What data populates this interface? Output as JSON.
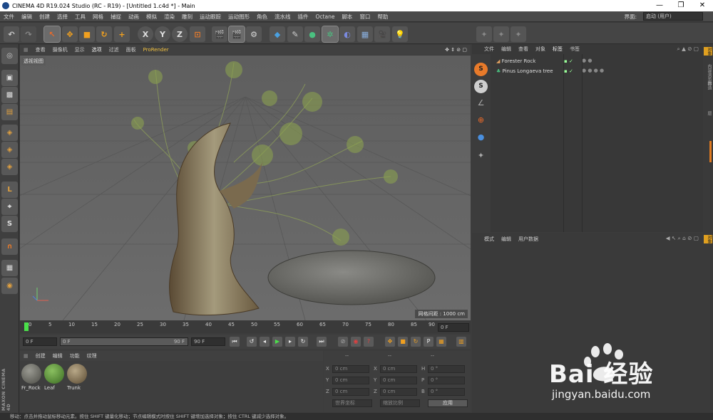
{
  "window": {
    "title": "CINEMA 4D R19.024 Studio (RC - R19) - [Untitled 1.c4d *] - Main",
    "min": "—",
    "max": "❐",
    "close": "✕"
  },
  "menu": [
    "文件",
    "编辑",
    "创建",
    "选择",
    "工具",
    "网格",
    "捕捉",
    "动画",
    "模拟",
    "渲染",
    "雕刻",
    "运动跟踪",
    "运动图形",
    "角色",
    "流水线",
    "插件",
    "Octane",
    "脚本",
    "窗口",
    "帮助"
  ],
  "layout": {
    "label": "界面:",
    "value": "启动 (用户)"
  },
  "viewport": {
    "menu": [
      "查看",
      "摄像机",
      "显示",
      "选项",
      "过滤",
      "面板",
      "ProRender"
    ],
    "label": "透视视图",
    "grid_label": "网格间距 : 1000 cm"
  },
  "timeline": {
    "ticks": [
      "0",
      "5",
      "10",
      "15",
      "20",
      "25",
      "30",
      "35",
      "40",
      "45",
      "50",
      "55",
      "60",
      "65",
      "70",
      "75",
      "80",
      "85",
      "90"
    ],
    "frame_end": "0 F"
  },
  "transport": {
    "start": "0 F",
    "current": "0 F",
    "range_end": "90 F",
    "end": "90 F"
  },
  "materials": {
    "menu": [
      "创建",
      "编辑",
      "功能",
      "纹理"
    ],
    "items": [
      {
        "name": "Fr_Rock",
        "color": "#6a6a62"
      },
      {
        "name": "Leaf",
        "color": "#5a8a3a"
      },
      {
        "name": "Trunk",
        "color": "#8a7a5a"
      }
    ]
  },
  "coords": {
    "headers": [
      "--",
      "--",
      "--"
    ],
    "rows": [
      {
        "a": "X",
        "av": "0 cm",
        "b": "X",
        "bv": "0 cm",
        "c": "H",
        "cv": "0 °"
      },
      {
        "a": "Y",
        "av": "0 cm",
        "b": "Y",
        "bv": "0 cm",
        "c": "P",
        "cv": "0 °"
      },
      {
        "a": "Z",
        "av": "0 cm",
        "b": "Z",
        "bv": "0 cm",
        "c": "B",
        "cv": "0 °"
      }
    ],
    "world": "世界坐标",
    "scale": "缩放比例",
    "apply": "应用"
  },
  "objects": {
    "menu": [
      "文件",
      "编辑",
      "查看",
      "对象",
      "标签",
      "书签"
    ],
    "items": [
      "Forester Rock",
      "Pinus Longaeva tree"
    ]
  },
  "attributes": {
    "menu": [
      "模式",
      "编辑",
      "用户数据"
    ]
  },
  "right_tabs": [
    "对象",
    "内容浏览器",
    "构造",
    "层"
  ],
  "brand": {
    "line1": "MAXON",
    "line2": "CINEMA 4D"
  },
  "status": "移动：点击并拖动鼠标移动元素。按住 SHIFT 键量化移动；节点编辑模式时按住 SHIFT 键增加选择对象；按住 CTRL 键减少选择对象。",
  "watermark": {
    "logo": "Bai 经验",
    "url": "jingyan.baidu.com"
  }
}
